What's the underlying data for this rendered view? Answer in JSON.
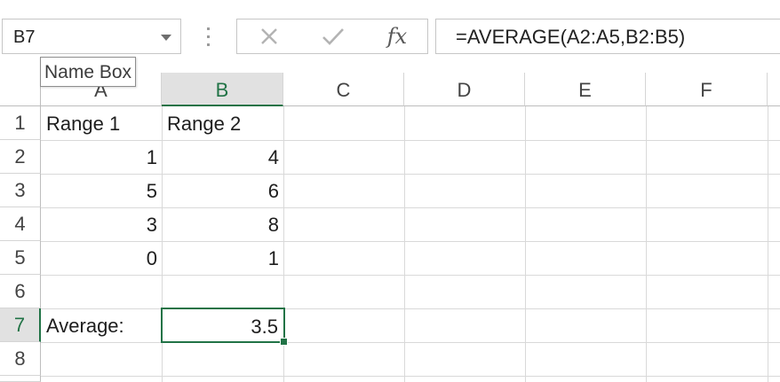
{
  "name_box": {
    "value": "B7",
    "tooltip": "Name Box"
  },
  "formula_bar": {
    "fx_label": "fx",
    "formula": "=AVERAGE(A2:A5,B2:B5)"
  },
  "columns": [
    "A",
    "B",
    "C",
    "D",
    "E",
    "F"
  ],
  "rows": [
    "1",
    "2",
    "3",
    "4",
    "5",
    "6",
    "7",
    "8"
  ],
  "cells": {
    "A1": "Range 1",
    "B1": "Range 2",
    "A2": "1",
    "B2": "4",
    "A3": "5",
    "B3": "6",
    "A4": "3",
    "B4": "8",
    "A5": "0",
    "B5": "1",
    "A7": "Average:",
    "B7": "3.5"
  },
  "selection": {
    "active_cell": "B7",
    "selected_column": "B",
    "selected_row": "7"
  },
  "colors": {
    "accent": "#217346",
    "gridline": "#d9d9d9",
    "header_selected_bg": "#e1e1e1"
  }
}
